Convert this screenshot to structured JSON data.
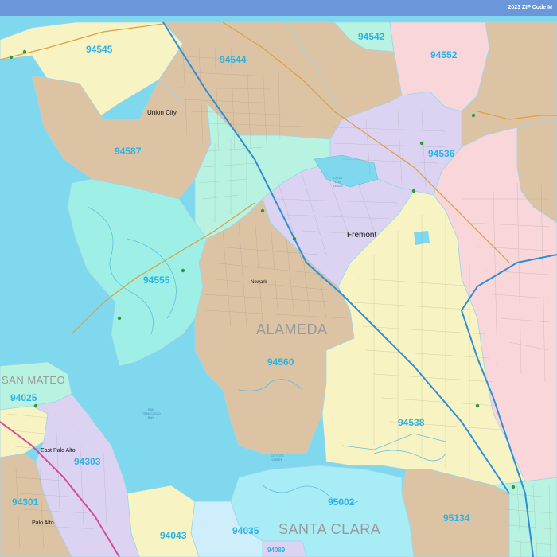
{
  "header": {
    "title": "2023 ZIP Code M"
  },
  "counties": {
    "alameda": "ALAMEDA",
    "santa_clara": "SANTA CLARA",
    "san_mateo": "SAN MATEO"
  },
  "zip_codes": {
    "z94545": "94545",
    "z94544": "94544",
    "z94542": "94542",
    "z94552": "94552",
    "z94587": "94587",
    "z94536": "94536",
    "z94555": "94555",
    "z94560": "94560",
    "z94538": "94538",
    "z94025": "94025",
    "z94303": "94303",
    "z94301": "94301",
    "z94043": "94043",
    "z94035": "94035",
    "z95002": "95002",
    "z95134": "95134",
    "z94089": "94089"
  },
  "cities": {
    "union_city": "Union City",
    "fremont": "Fremont",
    "newark": "Newark",
    "east_palo_alto": "East Palo Alto",
    "palo_alto": "Palo Alto"
  },
  "water_labels": {
    "san_francisco_bay": "SAN\nFRANCISCO\nBAY",
    "coyote_creek": "COYOTE\nCREEK",
    "lago_los_osos": "LAGO\nLOS\nOSOS"
  },
  "colors": {
    "water": "#7fd8ee",
    "tan": "#dcc3a4",
    "yellow": "#f7f3c2",
    "mint": "#b8f2e0",
    "pink": "#f8d6da",
    "lavender": "#dcd3f3",
    "aqua": "#9ef0e6",
    "zip_label": "#2bb3e6",
    "header": "#6a96da",
    "freeway": "#2f8fd6",
    "highway": "#e0a040"
  }
}
